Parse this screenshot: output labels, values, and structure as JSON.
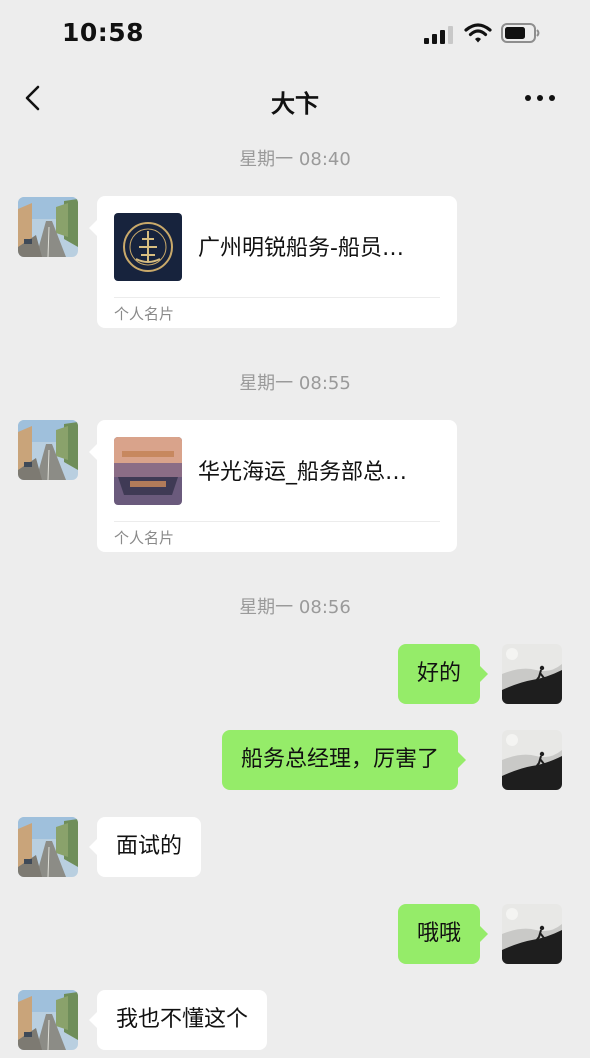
{
  "status_bar": {
    "time": "10:58"
  },
  "header": {
    "title": "大卞"
  },
  "messages": [
    {
      "type": "timestamp",
      "text": "星期一 08:40"
    },
    {
      "type": "contact_card",
      "side": "left",
      "name": "广州明锐船务-船员…",
      "label": "个人名片"
    },
    {
      "type": "timestamp",
      "text": "星期一 08:55"
    },
    {
      "type": "contact_card",
      "side": "left",
      "name": "华光海运_船务部总…",
      "label": "个人名片"
    },
    {
      "type": "timestamp",
      "text": "星期一 08:56"
    },
    {
      "type": "text",
      "side": "right",
      "text": "好的"
    },
    {
      "type": "text",
      "side": "right",
      "text": "船务总经理，厉害了"
    },
    {
      "type": "text",
      "side": "left",
      "text": "面试的"
    },
    {
      "type": "text",
      "side": "right",
      "text": "哦哦"
    },
    {
      "type": "text",
      "side": "left",
      "text": "我也不懂这个"
    }
  ],
  "colors": {
    "background": "#ededed",
    "outgoing_bubble": "#95ec69",
    "incoming_bubble": "#ffffff",
    "timestamp": "#9a9a9a"
  },
  "icons": [
    "back-arrow-icon",
    "more-dots-icon",
    "signal-icon",
    "wifi-icon",
    "battery-icon"
  ]
}
